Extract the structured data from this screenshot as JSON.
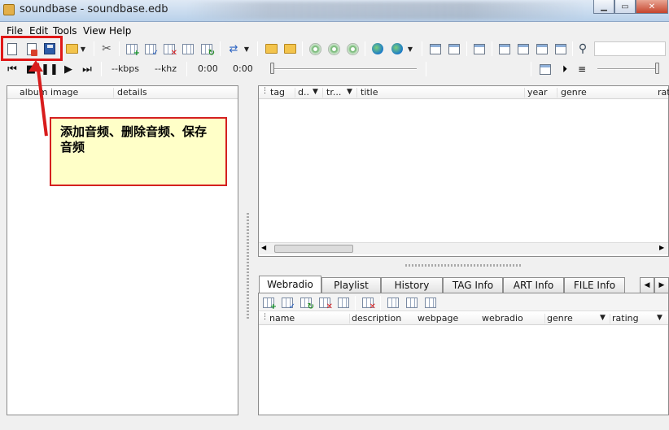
{
  "window": {
    "title": "soundbase - soundbase.edb"
  },
  "menu": [
    {
      "id": "file",
      "label": "File"
    },
    {
      "id": "edit",
      "label": "Edit"
    },
    {
      "id": "tools",
      "label": "Tools"
    },
    {
      "id": "view",
      "label": "View"
    },
    {
      "id": "help",
      "label": "Help"
    }
  ],
  "player": {
    "kbps": "--kbps",
    "khz": "--khz",
    "time_elapsed": "0:00",
    "time_total": "0:00",
    "position": 0,
    "volume": 1.0
  },
  "left_panel": {
    "columns": [
      "album image",
      "details"
    ]
  },
  "track_list": {
    "columns": [
      "tag",
      "d..",
      "tr...",
      "title",
      "year",
      "genre",
      "rat"
    ]
  },
  "tabs": [
    "Webradio",
    "Playlist",
    "History",
    "TAG Info",
    "ART Info",
    "FILE Info"
  ],
  "active_tab": "Webradio",
  "webradio": {
    "columns": [
      "name",
      "description",
      "webpage",
      "webradio",
      "genre",
      "rating"
    ]
  },
  "annotation": {
    "text": "添加音频、删除音频、保存音频"
  },
  "colors": {
    "accent_red": "#e01818",
    "callout_bg": "#ffffc8"
  }
}
